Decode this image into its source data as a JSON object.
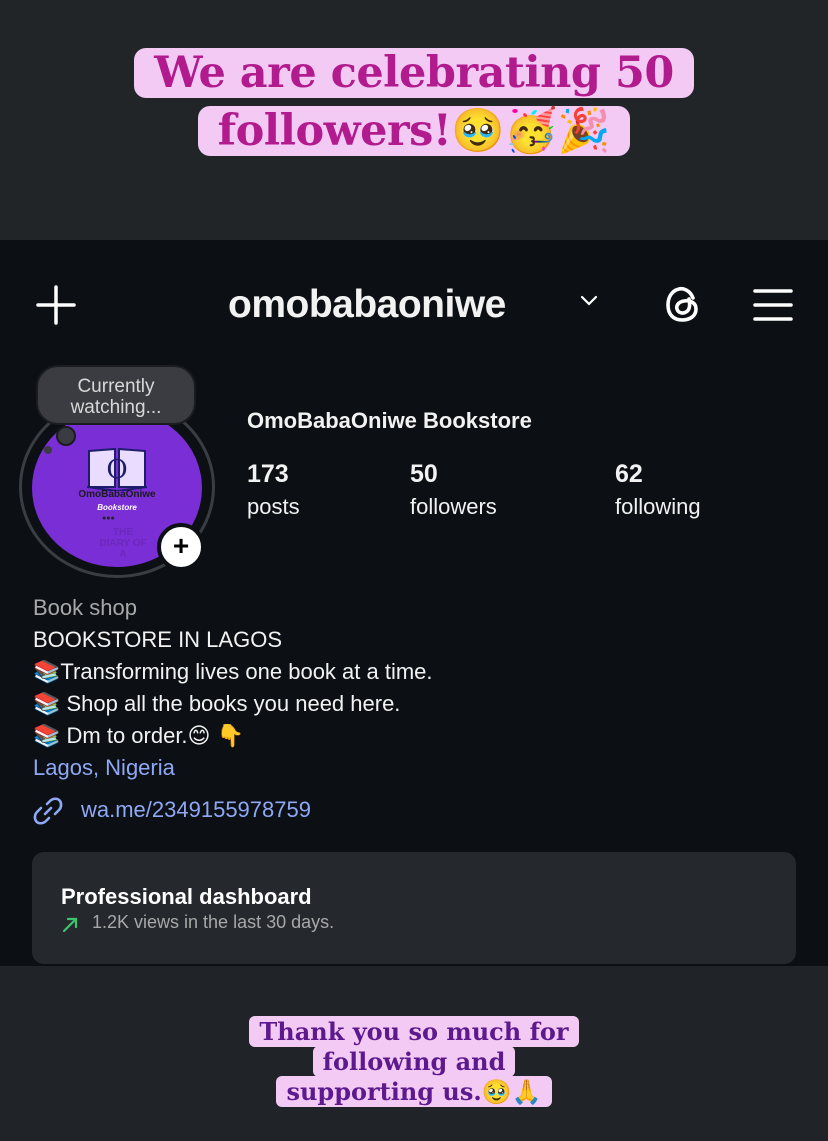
{
  "story": {
    "banner_top_line1": "We are celebrating 50",
    "banner_top_line2": "followers!🥹🥳🎉",
    "banner_bottom_line1": "Thank you so much for",
    "banner_bottom_line2": "following and",
    "banner_bottom_line3": "supporting us.🥹🙏"
  },
  "header": {
    "username": "omobabaoniwe"
  },
  "avatar": {
    "overlay_line1": "Currently",
    "overlay_line2": "watching...",
    "logo_name": "OmoBabaOniwe",
    "logo_sub": "Bookstore",
    "logo_letter": "O",
    "background_text": "THE DIARY OF A"
  },
  "profile": {
    "display_name": "OmoBabaOniwe Bookstore",
    "stats": [
      {
        "value": "173",
        "label": "posts"
      },
      {
        "value": "50",
        "label": "followers"
      },
      {
        "value": "62",
        "label": "following"
      }
    ],
    "category": "Book shop",
    "bio_lines": [
      "BOOKSTORE IN LAGOS",
      "📚Transforming lives one book at a time.",
      "📚 Shop all the books you need here.",
      "📚 Dm to order.😊 👇"
    ],
    "location": "Lagos, Nigeria",
    "link": "wa.me/2349155978759"
  },
  "dashboard": {
    "title": "Professional dashboard",
    "subtitle": "1.2K views in the last 30 days."
  },
  "colors": {
    "story_text_top": "#b21b8e",
    "story_text_bottom": "#5c1a8e",
    "story_highlight": "#f3caf3",
    "link_blue": "#8fa8f5",
    "avatar_purple": "#7a2ed6",
    "trend_green": "#3ec46d"
  }
}
